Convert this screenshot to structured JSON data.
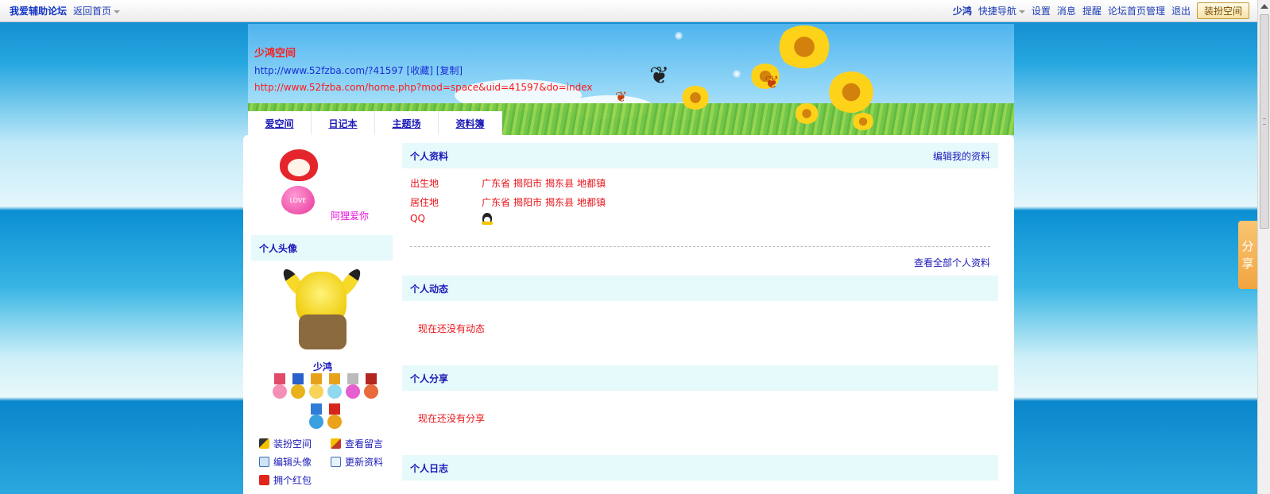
{
  "topbar": {
    "site_name": "我爱辅助论坛",
    "back_home": "返回首页",
    "username": "少鸿",
    "quick_nav": "快捷导航",
    "settings": "设置",
    "messages": "消息",
    "reminders": "提醒",
    "forum_admin": "论坛首页管理",
    "logout": "退出",
    "dress_space": "装扮空间"
  },
  "share_tab": {
    "line1": "分",
    "line2": "享"
  },
  "banner": {
    "space_title": "少鸿空间",
    "short_url": "http://www.52fzba.com/?41597",
    "favorite": "[收藏]",
    "copy": "[复制]",
    "full_url": "http://www.52fzba.com/home.php?mod=space&uid=41597&do=index"
  },
  "nav": {
    "tabs": [
      "爱空间",
      "日记本",
      "主题场",
      "资料簿"
    ]
  },
  "sidebar": {
    "pet_caption": "阿狸爱你",
    "pet_badge": "LOVE",
    "avatar_title": "个人头像",
    "username": "少鸿",
    "actions": {
      "dress_space": "装扮空间",
      "view_comments": "查看留言",
      "edit_avatar": "编辑头像",
      "update_profile": "更新资料",
      "red_packet": "拥个红包"
    }
  },
  "profile": {
    "title": "个人资料",
    "edit_link": "编辑我的资料",
    "rows": [
      {
        "key": "出生地",
        "values": [
          "广东省",
          "揭阳市",
          "揭东县",
          "地都镇"
        ]
      },
      {
        "key": "居住地",
        "values": [
          "广东省",
          "揭阳市",
          "揭东县",
          "地都镇"
        ]
      },
      {
        "key": "QQ"
      }
    ],
    "view_all": "查看全部个人资料"
  },
  "feed": {
    "title": "个人动态",
    "empty": "现在还没有动态"
  },
  "shares": {
    "title": "个人分享",
    "empty": "现在还没有分享"
  },
  "diary": {
    "title": "个人日志"
  },
  "colors": {
    "link_blue": "#1a1ab8",
    "text_red": "#e8141a",
    "section_bg": "#e6f9fb"
  }
}
